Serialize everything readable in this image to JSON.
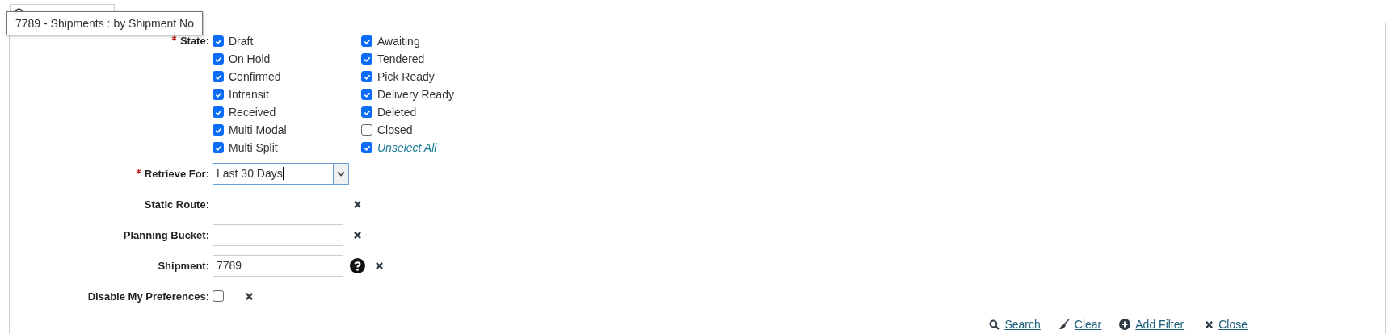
{
  "tooltip": "7789 - Shipments : by Shipment No",
  "state": {
    "label": "State:",
    "required": true,
    "options": [
      {
        "label": "Draft",
        "checked": true
      },
      {
        "label": "On Hold",
        "checked": true
      },
      {
        "label": "Confirmed",
        "checked": true
      },
      {
        "label": "Intransit",
        "checked": true
      },
      {
        "label": "Received",
        "checked": true
      },
      {
        "label": "Multi Modal",
        "checked": true
      },
      {
        "label": "Multi Split",
        "checked": true
      },
      {
        "label": "Awaiting",
        "checked": true
      },
      {
        "label": "Tendered",
        "checked": true
      },
      {
        "label": "Pick Ready",
        "checked": true
      },
      {
        "label": "Delivery Ready",
        "checked": true
      },
      {
        "label": "Deleted",
        "checked": true
      },
      {
        "label": "Closed",
        "checked": false
      }
    ],
    "toggle_all": {
      "label": "Unselect All",
      "checked": true
    }
  },
  "fields": [
    {
      "kind": "select",
      "label": "Retrieve For:",
      "required": true,
      "value": "Last 30 Days"
    },
    {
      "kind": "text",
      "label": "Static Route:",
      "required": false
    },
    {
      "kind": "text",
      "label": "Planning Bucket:",
      "required": false
    },
    {
      "kind": "text-help",
      "label": "Shipment:",
      "required": false,
      "value": "7789"
    },
    {
      "kind": "checkbox",
      "label": "Disable My Preferences:",
      "required": false,
      "checked": false
    }
  ],
  "actions": [
    {
      "kind": "search",
      "label": "Search"
    },
    {
      "kind": "clear",
      "label": "Clear"
    },
    {
      "kind": "add",
      "label": "Add Filter"
    },
    {
      "kind": "close",
      "label": "Close"
    }
  ]
}
